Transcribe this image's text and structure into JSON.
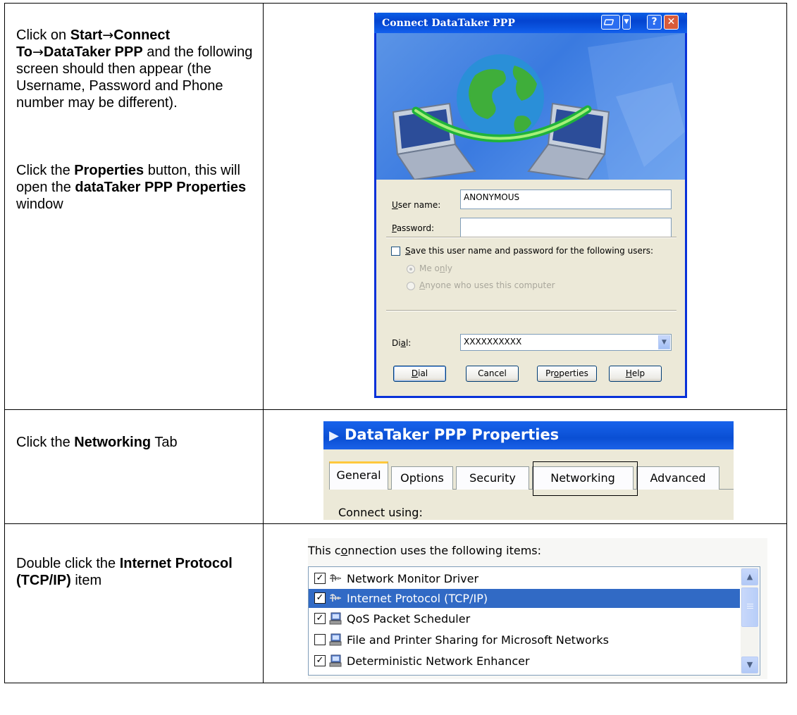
{
  "steps": [
    {
      "segments": [
        {
          "text": "Click on ",
          "bold": false
        },
        {
          "text": "Start",
          "bold": true
        },
        {
          "text": "→",
          "bold": false,
          "arrow": true
        },
        {
          "text": "Connect To",
          "bold": true
        },
        {
          "text": "→",
          "bold": false,
          "arrow": true
        },
        {
          "text": "DataTaker PPP",
          "bold": true
        },
        {
          "text": " and the following screen should then appear (the Username, Password and Phone number may be different).",
          "bold": false
        }
      ],
      "segments2": [
        {
          "text": "Click the ",
          "bold": false
        },
        {
          "text": "Properties",
          "bold": true
        },
        {
          "text": " button, this will open the ",
          "bold": false
        },
        {
          "text": "dataTaker PPP Properties",
          "bold": true
        },
        {
          "text": " window",
          "bold": false
        }
      ]
    },
    {
      "segments": [
        {
          "text": "Click the ",
          "bold": false
        },
        {
          "text": "Networking",
          "bold": true
        },
        {
          "text": " Tab",
          "bold": false
        }
      ]
    },
    {
      "segments": [
        {
          "text": "Double click the ",
          "bold": false
        },
        {
          "text": "Internet Protocol (TCP/IP)",
          "bold": true
        },
        {
          "text": " item",
          "bold": false
        }
      ]
    }
  ],
  "connect_dialog": {
    "title": "Connect DataTaker PPP",
    "username_label_accel": "U",
    "username_label_rest": "ser name:",
    "username_value": "ANONYMOUS",
    "password_label_accel": "P",
    "password_label_rest": "assword:",
    "password_value": "",
    "save_check_accel": "S",
    "save_check_rest": "ave this user name and password for the following users:",
    "radio_me_pre": "Me o",
    "radio_me_accel": "n",
    "radio_me_post": "ly",
    "radio_anyone_accel": "A",
    "radio_anyone_rest": "nyone who uses this computer",
    "dial_label_pre": "Di",
    "dial_label_accel": "a",
    "dial_label_post": "l:",
    "dial_value": "XXXXXXXXXX",
    "buttons": {
      "dial_accel": "D",
      "dial_rest": "ial",
      "cancel": "Cancel",
      "properties_pre": "Pr",
      "properties_accel": "o",
      "properties_post": "perties",
      "help_accel": "H",
      "help_rest": "elp"
    },
    "titlebar_help": "?",
    "titlebar_close": "✕"
  },
  "properties_window": {
    "title": "DataTaker PPP Properties",
    "tabs": [
      "General",
      "Options",
      "Security",
      "Networking",
      "Advanced"
    ],
    "connect_using": "Connect using:"
  },
  "items_list": {
    "heading_pre": "This c",
    "heading_accel": "o",
    "heading_post": "nnection uses the following items:",
    "items": [
      {
        "label": "Network Monitor Driver",
        "checked": true,
        "icon": "network-protocol-icon"
      },
      {
        "label": "Internet Protocol (TCP/IP)",
        "checked": true,
        "icon": "network-protocol-icon",
        "selected": true
      },
      {
        "label": "QoS Packet Scheduler",
        "checked": true,
        "icon": "network-service-icon"
      },
      {
        "label": "File and Printer Sharing for Microsoft Networks",
        "checked": false,
        "icon": "network-service-icon"
      },
      {
        "label": "Deterministic Network Enhancer",
        "checked": true,
        "icon": "network-service-icon"
      }
    ]
  }
}
